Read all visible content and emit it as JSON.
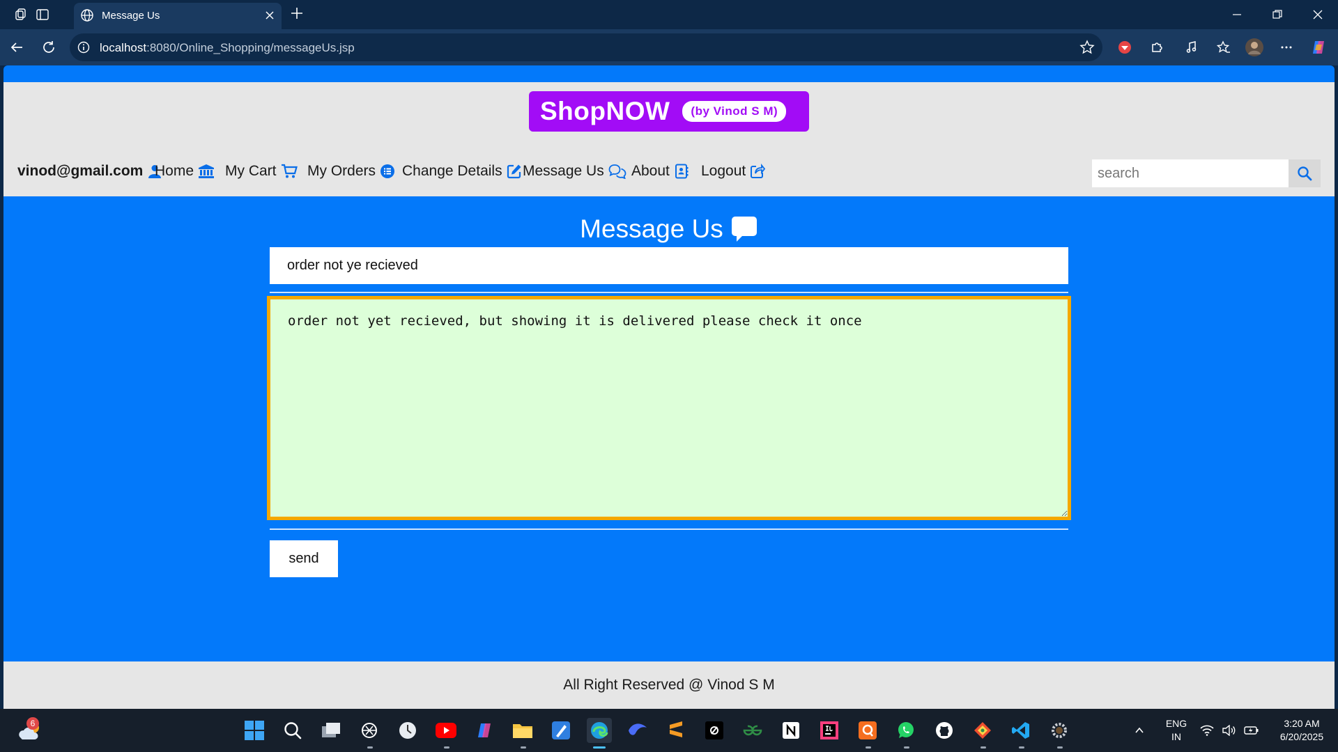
{
  "browser": {
    "tab_title": "Message Us",
    "url_host": "localhost",
    "url_path": ":8080/Online_Shopping/messageUs.jsp"
  },
  "site": {
    "logo_main": "ShopNOW",
    "logo_sub": "(by Vinod S M)",
    "user_email": "vinod@gmail.com",
    "menu": {
      "home": "Home",
      "cart": "My Cart",
      "orders": "My Orders",
      "change_details": "Change Details",
      "message_us": "Message Us",
      "about": "About",
      "logout": "Logout"
    },
    "search_placeholder": "search"
  },
  "form": {
    "page_title": "Message Us",
    "subject_value": "order not ye recieved",
    "message_value": "order not yet recieved, but showing it is delivered please check it once",
    "send_label": "send"
  },
  "footer": {
    "text": "All Right Reserved @ Vinod S M"
  },
  "taskbar": {
    "weather_badge": "6",
    "lang_top": "ENG",
    "lang_bottom": "IN",
    "time": "3:20 AM",
    "date": "6/20/2025"
  },
  "colors": {
    "page_bg": "#0379fa",
    "header_bg": "#e6e6e6",
    "logo_bg": "#a20cf6",
    "textarea_bg": "#ddffd9",
    "textarea_border": "#f5a800",
    "icon_blue": "#0a6ee8"
  }
}
